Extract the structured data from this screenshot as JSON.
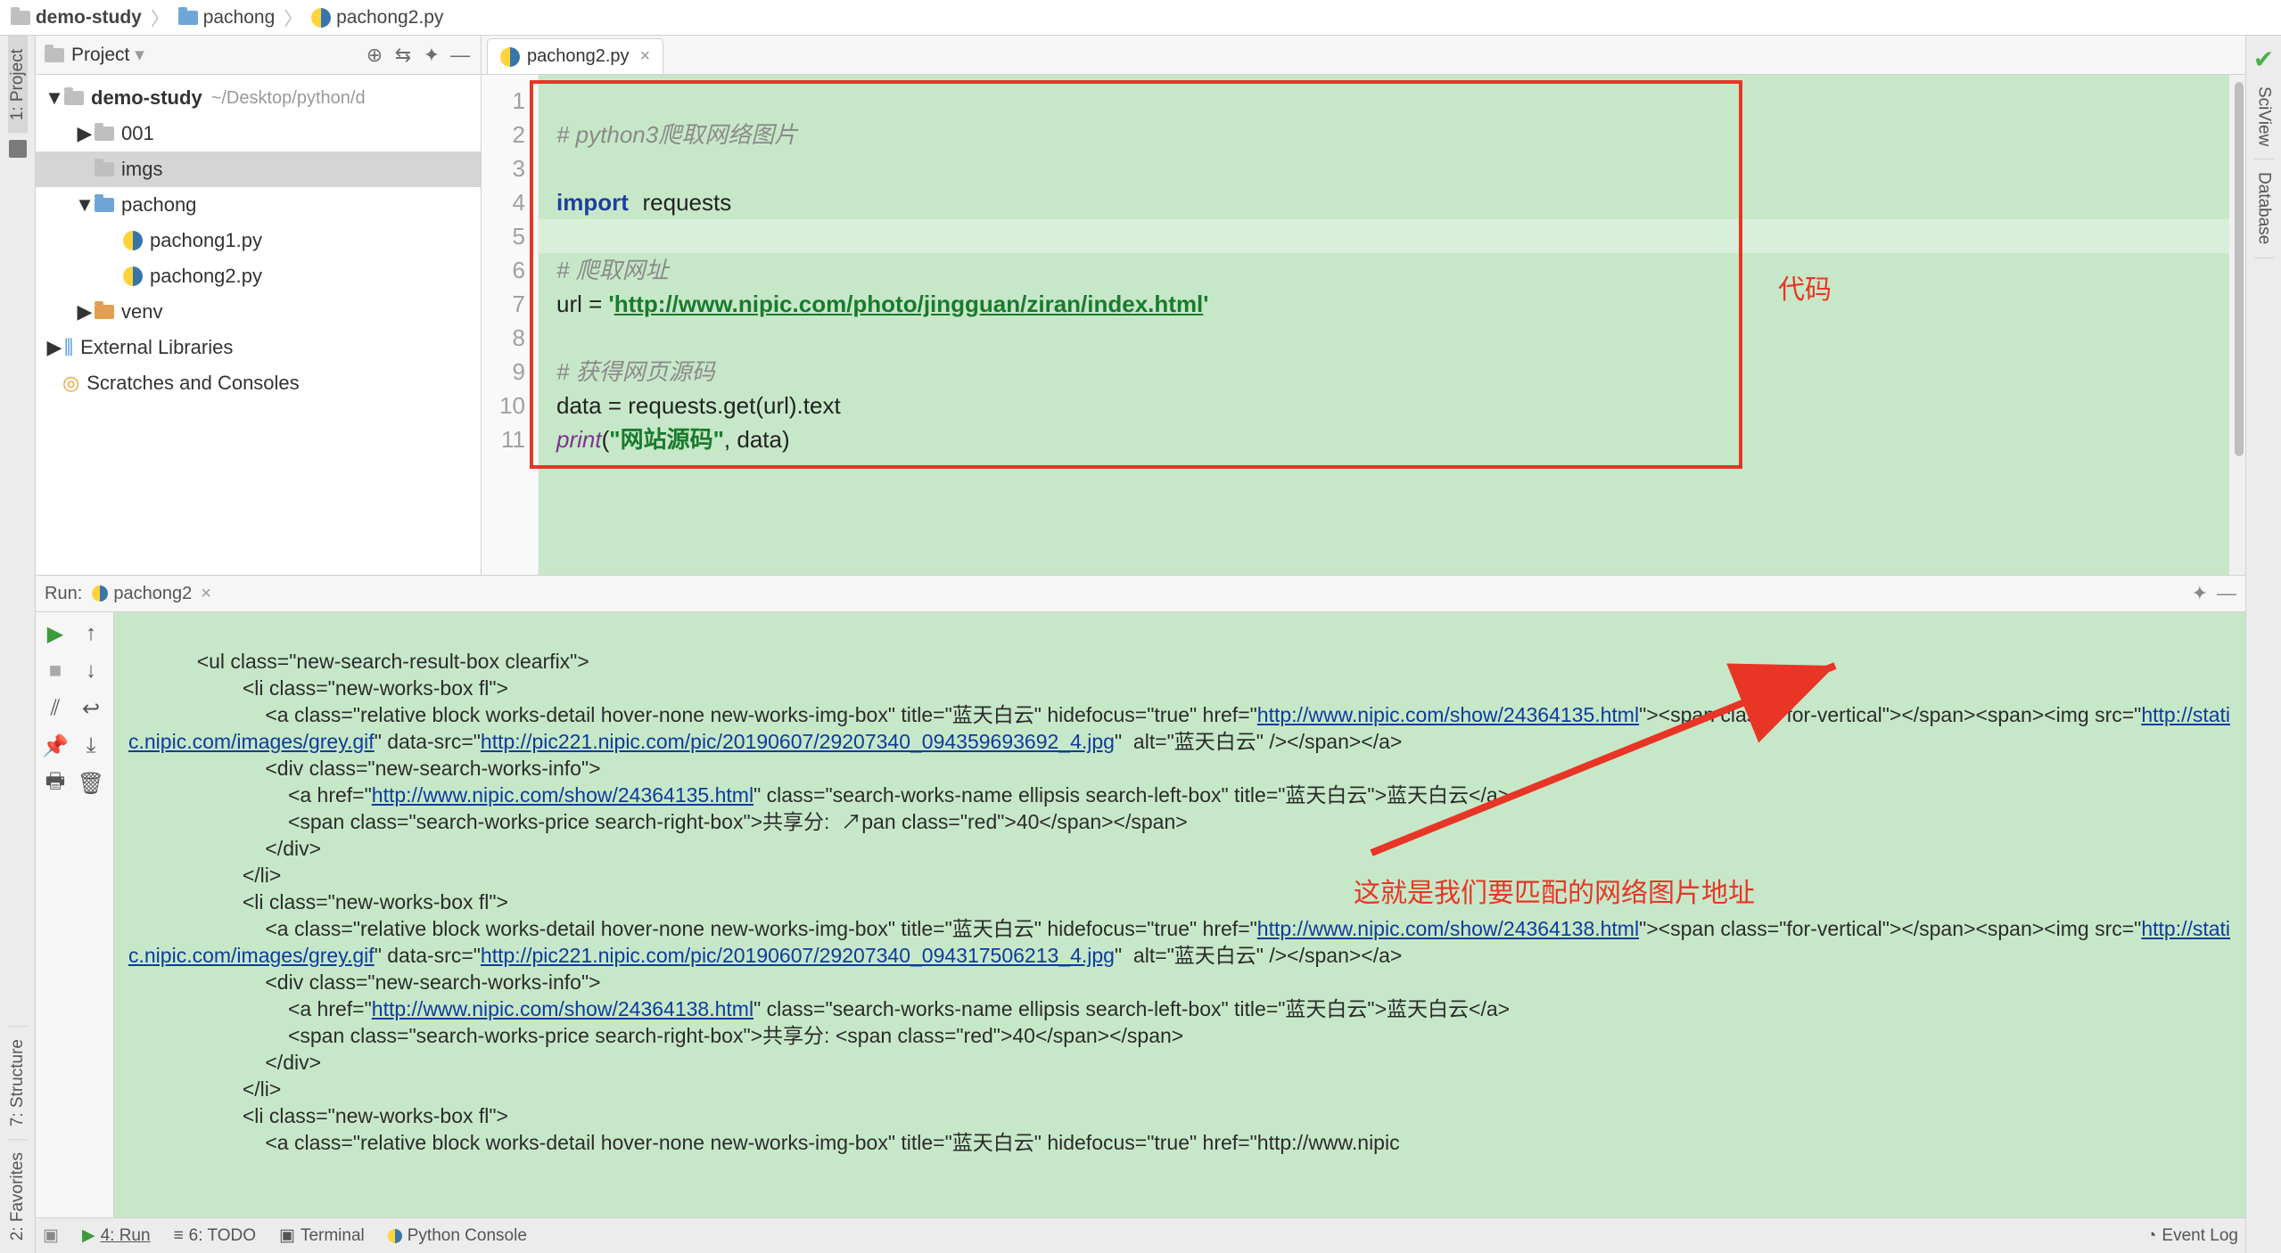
{
  "breadcrumbs": {
    "c1": "demo-study",
    "c2": "pachong",
    "c3": "pachong2.py"
  },
  "left_tabs": {
    "project": "1: Project",
    "structure": "7: Structure",
    "fav": "2: Favorites"
  },
  "right_tabs": {
    "sciview": "SciView",
    "database": "Database"
  },
  "project_header": {
    "title": "Project"
  },
  "tree": {
    "root_name": "demo-study",
    "root_path": "~/Desktop/python/d",
    "n_001": "001",
    "n_imgs": "imgs",
    "n_pachong": "pachong",
    "n_pachong1": "pachong1.py",
    "n_pachong2": "pachong2.py",
    "n_venv": "venv",
    "n_ext": "External Libraries",
    "n_scr": "Scratches and Consoles"
  },
  "tab": {
    "name": "pachong2.py"
  },
  "code": {
    "l1_comment": "# python3爬取网络图片",
    "l3_kw": "import",
    "l3_id": "requests",
    "l5_comment": "# 爬取网址",
    "l6_a": "url = ",
    "l6_q1": "'",
    "l6_url": "http://www.nipic.com/photo/jingguan/ziran/index.html",
    "l6_q2": "'",
    "l8_comment": "# 获得网页源码",
    "l9": "data = requests.get(url).text",
    "l10_pr": "print",
    "l10_open": "(",
    "l10_str": "\"网站源码\"",
    "l10_rest": ", data)",
    "lines": [
      "1",
      "2",
      "3",
      "4",
      "5",
      "6",
      "7",
      "8",
      "9",
      "10",
      "11"
    ]
  },
  "annot": {
    "code_label": "代码",
    "img_addr": "这就是我们要匹配的网络图片地址"
  },
  "run": {
    "label": "Run:",
    "config": "pachong2",
    "out1": "            <ul class=\"new-search-result-box clearfix\">",
    "out2": "                    <li class=\"new-works-box fl\">",
    "out3a": "                        <a class=\"relative block works-detail hover-none new-works-img-box\" title=\"蓝天白云\" hidefocus=\"true\" href=\"",
    "out3l": "http://www.nipic.com/show/24364135.html",
    "out3b": "\"><span class=\"for-vertical\"></span><span><img src=\"",
    "out3l2": "http://static.nipic.com/images/grey.gif",
    "out3c": "\" data-src=\"",
    "out3l3": "http://pic221.nipic.com/pic/20190607/29207340_094359693692_4.jpg",
    "out3d": "\"  alt=\"蓝天白云\" /></span></a>",
    "out4": "                        <div class=\"new-search-works-info\">",
    "out5a": "                            <a href=\"",
    "out5l": "http://www.nipic.com/show/24364135.html",
    "out5b": "\" class=\"search-works-name ellipsis search-left-box\" title=\"蓝天白云\">蓝天白云</a>",
    "out6": "                            <span class=\"search-works-price search-right-box\">共享分:  ↗pan class=\"red\">40</span></span>",
    "out7": "                        </div>",
    "out8": "                    </li>",
    "out9": "                    <li class=\"new-works-box fl\">",
    "out10a": "                        <a class=\"relative block works-detail hover-none new-works-img-box\" title=\"蓝天白云\" hidefocus=\"true\" href=\"",
    "out10l": "http://www.nipic.com/show/24364138.html",
    "out10b": "\"><span class=\"for-vertical\"></span><span><img src=\"",
    "out10l2": "http://static.nipic.com/images/grey.gif",
    "out10c": "\" data-src=\"",
    "out10l3": "http://pic221.nipic.com/pic/20190607/29207340_094317506213_4.jpg",
    "out10d": "\"  alt=\"蓝天白云\" /></span></a>",
    "out11": "                        <div class=\"new-search-works-info\">",
    "out12a": "                            <a href=\"",
    "out12l": "http://www.nipic.com/show/24364138.html",
    "out12b": "\" class=\"search-works-name ellipsis search-left-box\" title=\"蓝天白云\">蓝天白云</a>",
    "out13": "                            <span class=\"search-works-price search-right-box\">共享分: <span class=\"red\">40</span></span>",
    "out14": "                        </div>",
    "out15": "                    </li>",
    "out16": "                    <li class=\"new-works-box fl\">",
    "out17": "                        <a class=\"relative block works-detail hover-none new-works-img-box\" title=\"蓝天白云\" hidefocus=\"true\" href=\"http://www.nipic"
  },
  "bottom": {
    "run": "4: Run",
    "todo": "6: TODO",
    "terminal": "Terminal",
    "pyconsole": "Python Console",
    "eventlog": "Event Log"
  }
}
